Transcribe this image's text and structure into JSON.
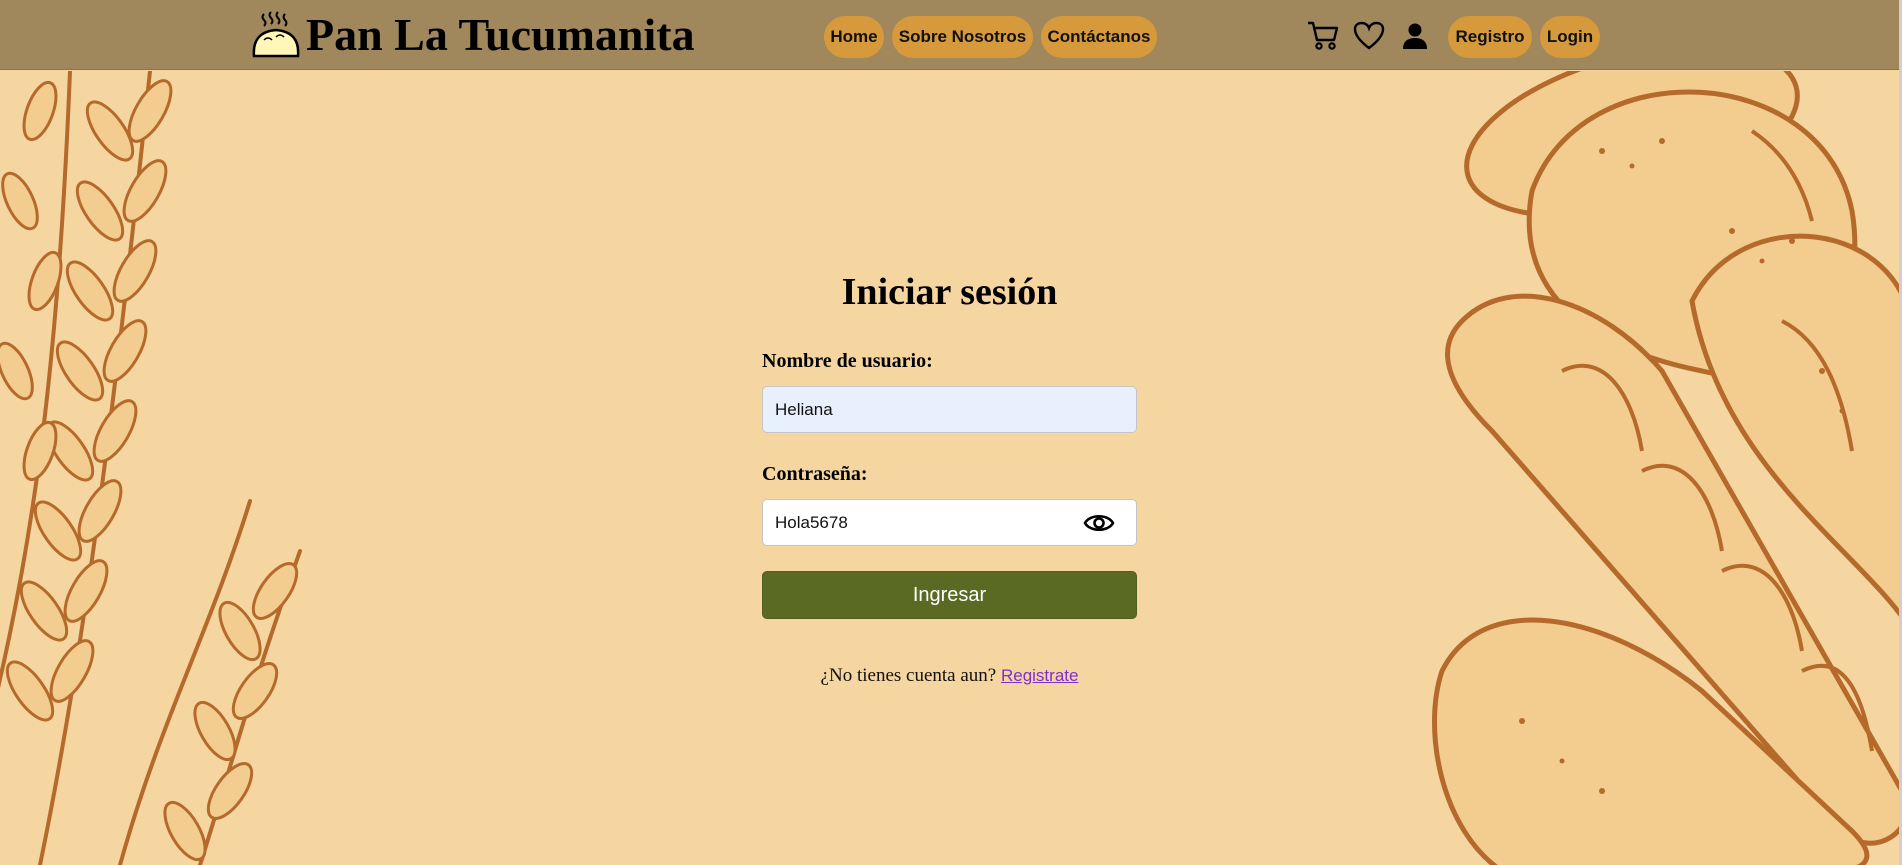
{
  "brand": {
    "title": "Pan La Tucumanita",
    "logo_icon": "bread-bun-icon"
  },
  "nav": {
    "links": [
      {
        "label": "Home"
      },
      {
        "label": "Sobre Nosotros"
      },
      {
        "label": "Contáctanos"
      }
    ],
    "icons": [
      "cart-icon",
      "heart-icon",
      "user-icon"
    ],
    "auth": [
      {
        "label": "Registro"
      },
      {
        "label": "Login"
      }
    ]
  },
  "login": {
    "title": "Iniciar sesión",
    "username_label": "Nombre de usuario:",
    "username_value": "Heliana",
    "password_label": "Contraseña:",
    "password_value": "Hola5678",
    "submit_label": "Ingresar",
    "signup_prompt": "¿No tienes cuenta aun?",
    "signup_link": "Registrate"
  },
  "colors": {
    "navbar": "#a0875c",
    "pill": "#d69a3c",
    "background": "#f5d5a0",
    "decoration": "#b56a2b",
    "submit": "#5b6a23",
    "link": "#7d2fd0"
  }
}
